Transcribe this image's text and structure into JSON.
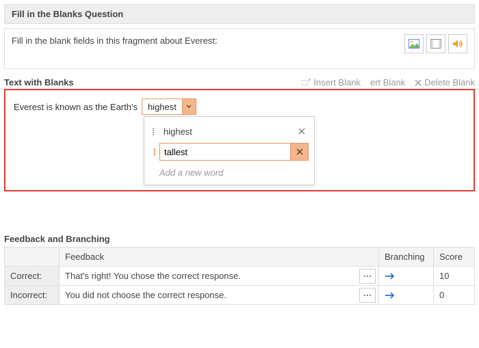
{
  "section1": {
    "title": "Fill in the Blanks Question",
    "prompt": "Fill in the blank fields in this fragment about Everest:"
  },
  "media": {
    "image": "image-icon",
    "video": "video-icon",
    "audio": "audio-icon"
  },
  "section2": {
    "title": "Text with Blanks",
    "toolbar": {
      "insert": "Insert Blank",
      "edit_fragment": "ert Blank",
      "delete": "Delete Blank"
    }
  },
  "sentence": {
    "prefix": "Everest is known as the Earth's",
    "selected": "highest"
  },
  "dropdown": {
    "options": [
      {
        "label": "highest"
      }
    ],
    "editing_value": "tallest",
    "add_hint": "Add a new word"
  },
  "feedback": {
    "title": "Feedback and Branching",
    "headers": {
      "blank": "",
      "feedback": "Feedback",
      "branching": "Branching",
      "score": "Score"
    },
    "rows": {
      "correct": {
        "label": "Correct:",
        "text": "That's right! You chose the correct response.",
        "score": "10"
      },
      "incorrect": {
        "label": "Incorrect:",
        "text": "You did not choose the correct response.",
        "score": "0"
      }
    }
  },
  "colors": {
    "accent": "#e9955f",
    "accent_fill": "#f3b68e",
    "danger_border": "#e03a2f",
    "link": "#2e6fd9"
  }
}
